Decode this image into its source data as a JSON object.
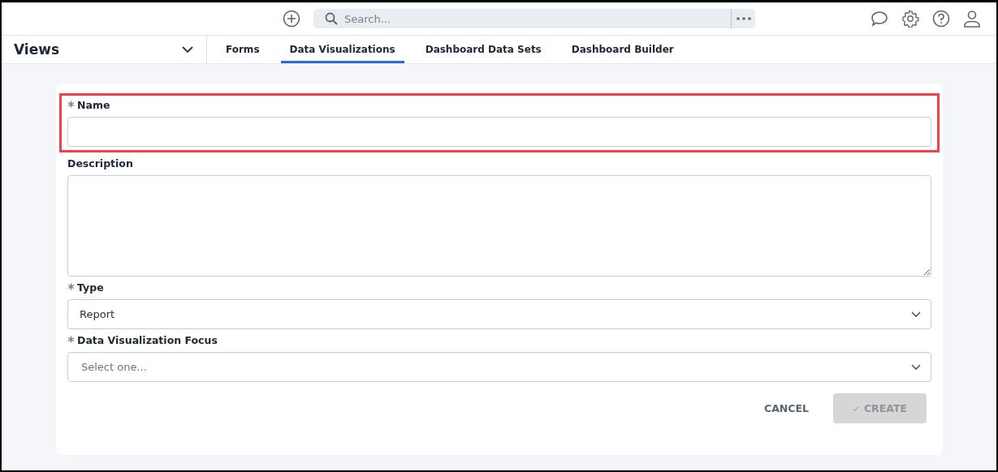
{
  "top_bar": {
    "search": {
      "placeholder": "Search..."
    }
  },
  "views": {
    "title": "Views",
    "expanded": false
  },
  "tabs": [
    {
      "label": "Forms",
      "selected": false
    },
    {
      "label": "Data Visualizations",
      "selected": true
    },
    {
      "label": "Dashboard Data Sets",
      "selected": false
    },
    {
      "label": "Dashboard Builder",
      "selected": false
    }
  ],
  "form": {
    "fields": [
      {
        "kind": "text",
        "label": "Name",
        "required": true,
        "highlighted": true
      },
      {
        "kind": "textarea",
        "label": "Description",
        "required": false
      },
      {
        "kind": "select",
        "label": "Type",
        "required": true,
        "value": "Report"
      },
      {
        "kind": "select",
        "label": "Data Visualization Focus",
        "required": true,
        "placeholder": "Select one..."
      }
    ],
    "buttons": [
      {
        "kind": "text",
        "label": "CANCEL",
        "disabled": false
      },
      {
        "kind": "primary",
        "label": "CREATE",
        "disabled": true
      }
    ]
  }
}
